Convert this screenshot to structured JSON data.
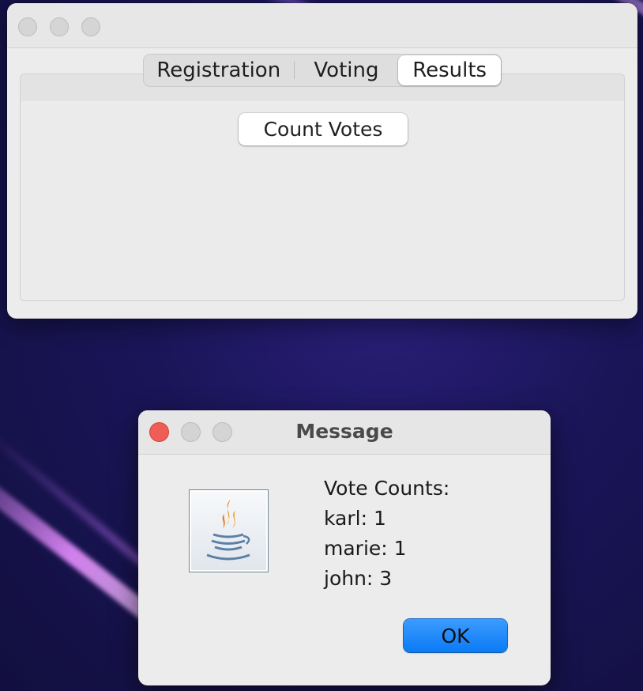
{
  "main_window": {
    "tabs": [
      {
        "label": "Registration"
      },
      {
        "label": "Voting"
      },
      {
        "label": "Results"
      }
    ],
    "selected_tab": "Results",
    "count_votes_label": "Count Votes"
  },
  "dialog": {
    "title": "Message",
    "icon": "java-logo-icon",
    "lines": [
      "Vote Counts:",
      "karl: 1",
      "marie: 1",
      "john: 3"
    ],
    "ok_label": "OK"
  },
  "colors": {
    "accent": "#0a7bf5",
    "close_red": "#ee5e57"
  }
}
